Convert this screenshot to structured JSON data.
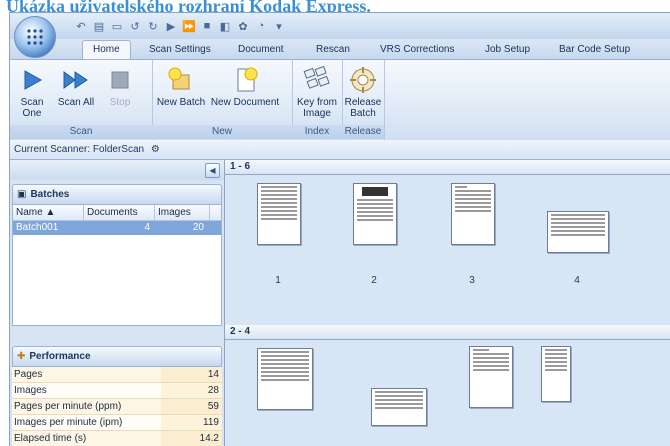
{
  "caption": "Ukázka uživatelského rozhraní Kodak Express.",
  "ribbon": {
    "tabs": [
      "Home",
      "Scan Settings",
      "Document",
      "Rescan",
      "VRS Corrections",
      "Job Setup",
      "Bar Code Setup"
    ],
    "active_tab": "Home",
    "groups": [
      {
        "label": "Scan",
        "buttons": [
          "Scan One",
          "Scan All",
          "Stop"
        ]
      },
      {
        "label": "New",
        "buttons": [
          "New Batch",
          "New Document"
        ]
      },
      {
        "label": "Index",
        "buttons": [
          "Key from Image"
        ]
      },
      {
        "label": "Release",
        "buttons": [
          "Release Batch"
        ]
      }
    ]
  },
  "scanner": {
    "text": "Current Scanner: FolderScan"
  },
  "batches": {
    "title": "Batches",
    "columns": [
      "Name",
      "Documents",
      "Images"
    ],
    "rows": [
      {
        "name": "Batch001",
        "documents": "4",
        "images": "20"
      }
    ]
  },
  "performance": {
    "title": "Performance",
    "rows": [
      {
        "label": "Pages",
        "value": "14"
      },
      {
        "label": "Images",
        "value": "28"
      },
      {
        "label": "Pages per minute (ppm)",
        "value": "59"
      },
      {
        "label": "Images per minute (ipm)",
        "value": "119"
      },
      {
        "label": "Elapsed time (s)",
        "value": "14.2"
      }
    ]
  },
  "documents": [
    {
      "range": "1 - 6",
      "thumbs": [
        "1",
        "2",
        "3",
        "4"
      ]
    },
    {
      "range": "2 - 4",
      "thumbs": []
    }
  ]
}
